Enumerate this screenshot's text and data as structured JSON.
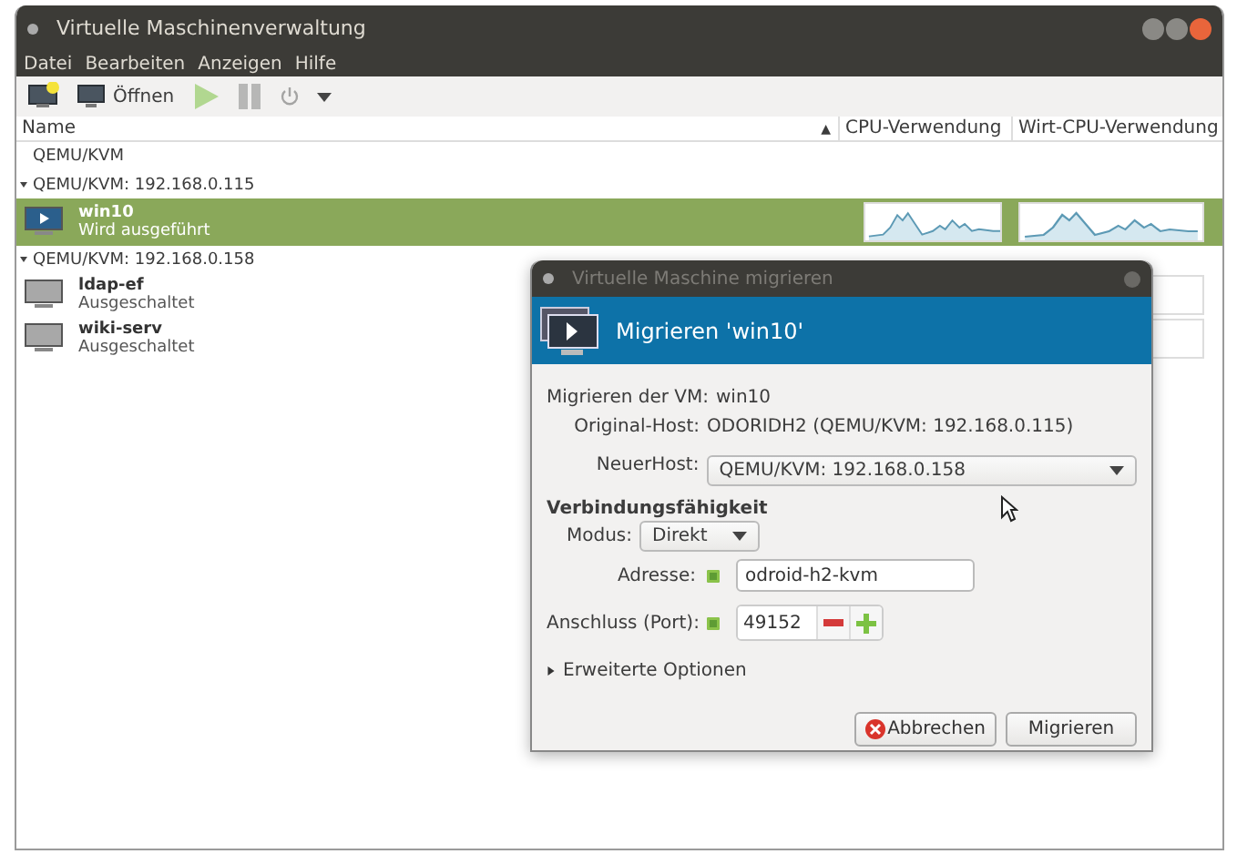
{
  "window": {
    "title": "Virtuelle Maschinenverwaltung"
  },
  "menu": [
    "Datei",
    "Bearbeiten",
    "Anzeigen",
    "Hilfe"
  ],
  "toolbar": [
    {
      "kind": "new",
      "disabled": false
    },
    {
      "kind": "open",
      "label": "Öffnen",
      "disabled": false
    },
    {
      "kind": "run",
      "disabled": true
    },
    {
      "kind": "pause",
      "disabled": true
    },
    {
      "kind": "power",
      "disabled": true
    },
    {
      "kind": "menu",
      "disabled": false
    }
  ],
  "table": {
    "columns": [
      {
        "label": "Name",
        "sort": "▲"
      },
      {
        "label": "CPU-Verwendung"
      },
      {
        "label": "Wirt-CPU-Verwendung"
      }
    ],
    "connections": [
      {
        "name": "QEMU/KVM"
      },
      {
        "name": "QEMU/KVM: 192.168.0.115",
        "children": [
          {
            "name": "win10",
            "status": "Wird ausgeführt",
            "running": true,
            "selected": true
          }
        ]
      },
      {
        "name": "QEMU/KVM: 192.168.0.158",
        "children": [
          {
            "name": "ldap-ef",
            "status": "Ausgeschaltet",
            "running": false,
            "selected": false
          },
          {
            "name": "wiki-serv",
            "status": "Ausgeschaltet",
            "running": false,
            "selected": false
          }
        ]
      }
    ]
  },
  "dialog": {
    "title": "Virtuelle Maschine migrieren",
    "header": "Migrieren 'win10'",
    "vm_label": "Migrieren der VM:",
    "vm_value": "win10",
    "orig_label": "Original-Host:",
    "orig_value": "ODORIDH2 (QEMU/KVM: 192.168.0.115)",
    "host_label": "NeuerHost:",
    "host_value": "QEMU/KVM: 192.168.0.158",
    "section": "Verbindungsfähigkeit",
    "mode_label": "Modus:",
    "mode_value": "Direkt",
    "address": {
      "label": "Adresse:",
      "checked": true,
      "value": "odroid-h2-kvm"
    },
    "port": {
      "label": "Anschluss (Port):",
      "checked": true,
      "value": "49152"
    },
    "advanced": {
      "label": "Erweiterte Optionen",
      "expanded": false
    },
    "buttons": [
      {
        "kind": "cancel",
        "label": "Abbrechen"
      },
      {
        "kind": "ok",
        "label": "Migrieren"
      }
    ]
  }
}
